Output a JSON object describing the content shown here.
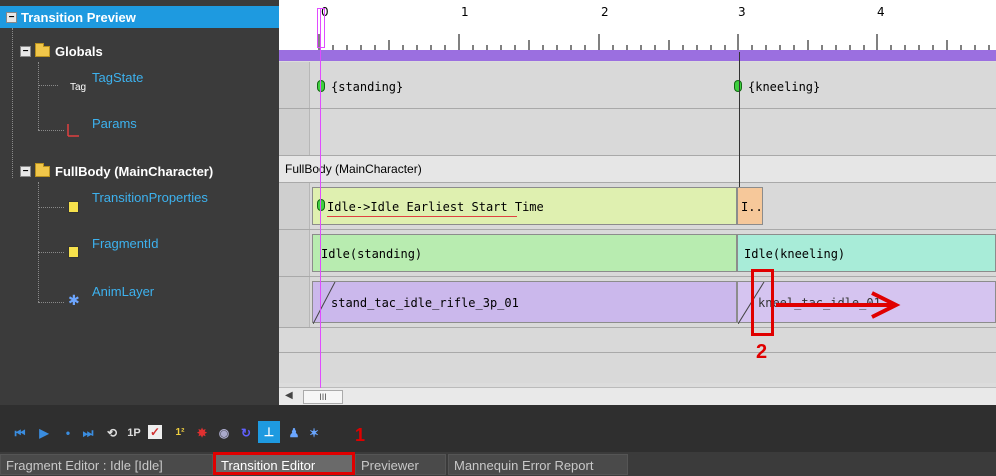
{
  "tree": {
    "root_label": "Transition Preview",
    "globals_label": "Globals",
    "tagstate_label": "TagState",
    "tag_icon_text": "Tag",
    "params_label": "Params",
    "fullbody_label": "FullBody (MainCharacter)",
    "transition_properties_label": "TransitionProperties",
    "fragment_id_label": "FragmentId",
    "anim_layer_label": "AnimLayer"
  },
  "timeline": {
    "ruler_numbers": [
      "0",
      "1",
      "2",
      "3",
      "4"
    ],
    "tag_standing": "{standing}",
    "tag_kneeling": "{kneeling}",
    "fullbody_header": "FullBody (MainCharacter)",
    "transition_clip": "Idle->Idle Earliest Start Time",
    "transition_clip_short": "I..",
    "fragment_standing": "Idle(standing)",
    "fragment_kneeling": "Idle(kneeling)",
    "anim_clip_1": "stand_tac_idle_rifle_3p_01",
    "anim_clip_2": "kneel_tac_idle_01",
    "scroll_grip": "III"
  },
  "tabs": [
    {
      "label": "Fragment Editor : Idle [Idle]"
    },
    {
      "label": "Transition Editor"
    },
    {
      "label": "Previewer"
    },
    {
      "label": "Mannequin Error Report"
    }
  ],
  "annotations": {
    "one": "1",
    "two": "2"
  },
  "toolbar_icons": [
    "skip-start-icon",
    "play-icon",
    "step-icon",
    "skip-end-icon",
    "loop-icon",
    "1p-icon",
    "checkbox-icon",
    "chart-icon",
    "bug-icon",
    "eye-icon",
    "anim-icon",
    "axis-icon",
    "users-icon",
    "run-icon"
  ],
  "colors": {
    "selected": "#1e9ae0",
    "purple_bar": "#9b6fe0",
    "clip_green": "#d2f0a0",
    "clip_green2": "#a8e6a8",
    "clip_teal": "#9fe8d8",
    "clip_purple": "#c8b4ec",
    "annotation_red": "#e00000"
  }
}
